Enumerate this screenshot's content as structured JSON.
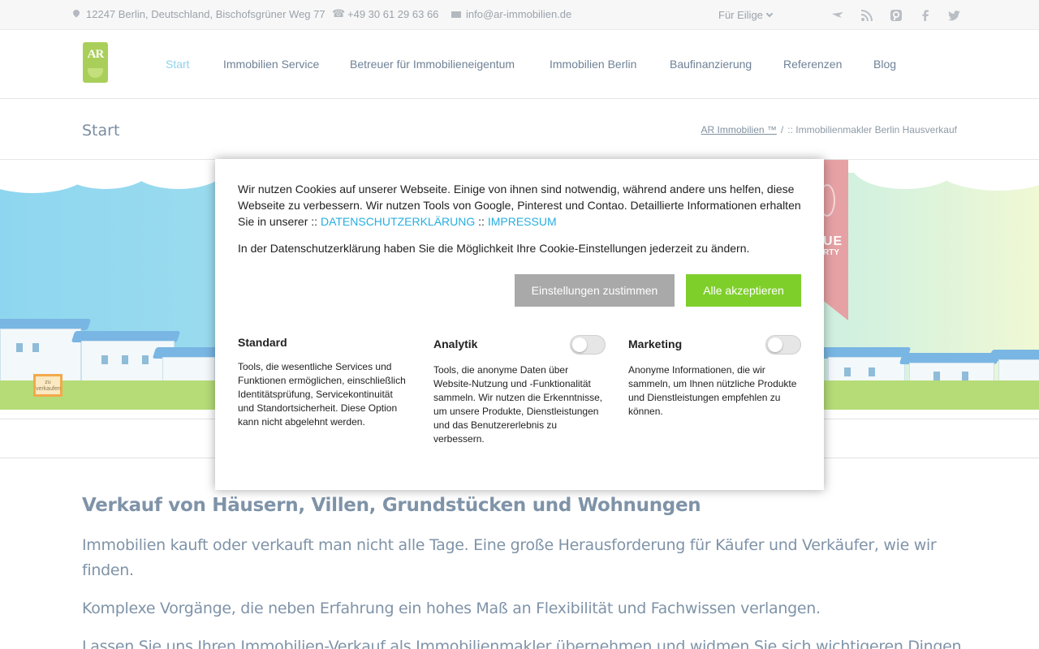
{
  "topbar": {
    "address": "12247 Berlin, Deutschland, Bischofsgrüner Weg 77",
    "phone": "+49 30 61 29 63 66",
    "email": "info@ar-immobilien.de",
    "dropdown_label": "Für Eilige",
    "social_icons": [
      "bird-icon",
      "rss-icon",
      "pinterest-icon",
      "facebook-icon",
      "twitter-icon"
    ]
  },
  "logo": {
    "text": "AR"
  },
  "nav": {
    "items": [
      {
        "label": "Start",
        "active": true
      },
      {
        "label": "Immobilien Service"
      },
      {
        "label": "Betreuer für Immobilieneigentum"
      },
      {
        "label": "Immobilien Berlin"
      },
      {
        "label": "Baufinanzierung"
      },
      {
        "label": "Referenzen"
      },
      {
        "label": "Blog"
      }
    ]
  },
  "page": {
    "title": "Start",
    "breadcrumb": {
      "home": "AR Immobilien ™",
      "separator": "/",
      "current": ":: Immobilienmakler Berlin Hausverkauf"
    }
  },
  "hero": {
    "sign_text": "zu verkaufen",
    "ribbon_line1": "UE",
    "ribbon_line2": "RTY"
  },
  "content": {
    "heading": "Verkauf von Häusern, Villen, Grundstücken und Wohnungen",
    "paragraphs": [
      "Immobilien kauft oder verkauft man nicht alle Tage. Eine große Herausforderung für Käufer und Verkäufer, wie wir finden.",
      "Komplexe Vorgänge, die neben Erfahrung ein hohes Maß an Flexibilität und Fachwissen verlangen.",
      "Lassen Sie uns Ihren Immobilien-Verkauf als Immobilienmakler übernehmen und widmen Sie sich wichtigeren Dingen"
    ]
  },
  "cookie": {
    "intro": "Wir nutzen Cookies auf unserer Webseite. Einige von ihnen sind notwendig, während andere uns helfen, diese Webseite zu verbessern. Wir nutzen Tools von Google, Pinterest und Contao. Detaillierte Informationen erhalten Sie in unserer ::",
    "privacy_link": "DATENSCHUTZERKLÄRUNG",
    "link_separator": "::",
    "imprint_link": "IMPRESSUM",
    "note": "In der Datenschutzerklärung haben Sie die Möglichkeit Ihre Cookie-Einstellungen jederzeit zu ändern.",
    "btn_settings": "Einstellungen zustimmen",
    "btn_accept": "Alle akzeptieren",
    "accent_color": "#7fcf2b",
    "link_color": "#27aee0",
    "categories": [
      {
        "title": "Standard",
        "desc": "Tools, die wesentliche Services und Funktionen ermöglichen, einschließlich Identitätsprüfung, Servicekontinuität und Standortsicherheit. Diese Option kann nicht abgelehnt werden.",
        "toggle": null
      },
      {
        "title": "Analytik",
        "desc": "Tools, die anonyme Daten über Website-Nutzung und -Funktionalität sammeln. Wir nutzen die Erkenntnisse, um unsere Produkte, Dienstleistungen und das Benutzererlebnis zu verbessern.",
        "toggle": false
      },
      {
        "title": "Marketing",
        "desc": "Anonyme Informationen, die wir sammeln, um Ihnen nützliche Produkte und Dienstleistungen empfehlen zu können.",
        "toggle": false
      }
    ]
  }
}
